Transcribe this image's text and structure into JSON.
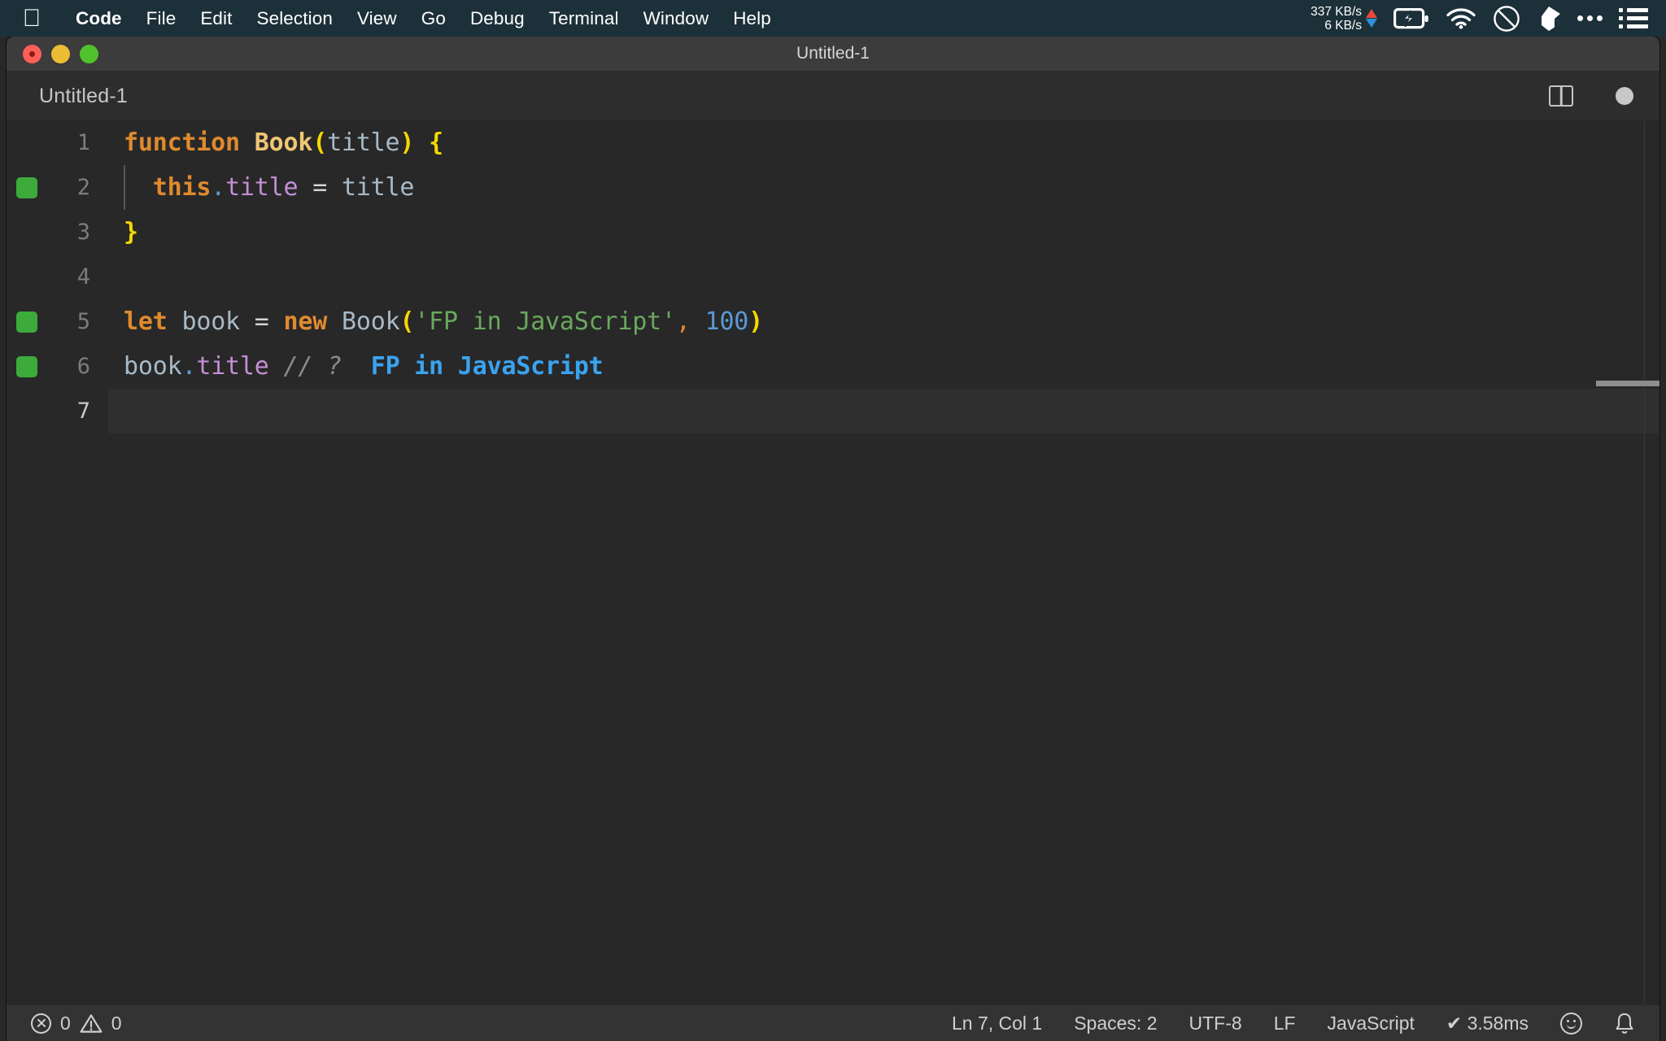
{
  "menubar": {
    "apple_icon": "apple-logo",
    "items": [
      {
        "label": "Code",
        "bold": true
      },
      {
        "label": "File",
        "bold": false
      },
      {
        "label": "Edit",
        "bold": false
      },
      {
        "label": "Selection",
        "bold": false
      },
      {
        "label": "View",
        "bold": false
      },
      {
        "label": "Go",
        "bold": false
      },
      {
        "label": "Debug",
        "bold": false
      },
      {
        "label": "Terminal",
        "bold": false
      },
      {
        "label": "Window",
        "bold": false
      },
      {
        "label": "Help",
        "bold": false
      }
    ],
    "status": {
      "net_up": "337 KB/s",
      "net_down": "6 KB/s",
      "icons": [
        "battery-charging-icon",
        "wifi-icon",
        "do-not-disturb-icon",
        "dropbox-icon",
        "ellipsis-icon",
        "list-icon"
      ]
    }
  },
  "window": {
    "title": "Untitled-1",
    "traffic_lights": [
      "close-button",
      "minimize-button",
      "maximize-button"
    ]
  },
  "tabbar": {
    "active_tab": "Untitled-1",
    "split_editor_icon": "split-editor-icon",
    "unsaved_dot": "unsaved-indicator-dot"
  },
  "editor": {
    "language": "JavaScript",
    "lines": [
      {
        "num": "1",
        "marker": false,
        "active": false,
        "indent_guide": false,
        "tokens": [
          {
            "t": "function",
            "c": "t-kw"
          },
          {
            "t": " ",
            "c": "t-op"
          },
          {
            "t": "Book",
            "c": "t-fn"
          },
          {
            "t": "(",
            "c": "t-paren"
          },
          {
            "t": "title",
            "c": "t-var"
          },
          {
            "t": ")",
            "c": "t-paren"
          },
          {
            "t": " ",
            "c": "t-op"
          },
          {
            "t": "{",
            "c": "t-brace"
          }
        ]
      },
      {
        "num": "2",
        "marker": true,
        "active": false,
        "indent_guide": true,
        "tokens": [
          {
            "t": "  ",
            "c": "t-op"
          },
          {
            "t": "this",
            "c": "t-kw"
          },
          {
            "t": ".",
            "c": "t-dot"
          },
          {
            "t": "title",
            "c": "t-prop"
          },
          {
            "t": " = ",
            "c": "t-op"
          },
          {
            "t": "title",
            "c": "t-var"
          }
        ]
      },
      {
        "num": "3",
        "marker": false,
        "active": false,
        "indent_guide": false,
        "tokens": [
          {
            "t": "}",
            "c": "t-brace"
          }
        ]
      },
      {
        "num": "4",
        "marker": false,
        "active": false,
        "indent_guide": false,
        "tokens": []
      },
      {
        "num": "5",
        "marker": true,
        "active": false,
        "indent_guide": false,
        "tokens": [
          {
            "t": "let",
            "c": "t-kw"
          },
          {
            "t": " ",
            "c": "t-op"
          },
          {
            "t": "book",
            "c": "t-var"
          },
          {
            "t": " = ",
            "c": "t-op"
          },
          {
            "t": "new",
            "c": "t-kw"
          },
          {
            "t": " ",
            "c": "t-op"
          },
          {
            "t": "Book",
            "c": "t-var"
          },
          {
            "t": "(",
            "c": "t-paren"
          },
          {
            "t": "'FP in JavaScript'",
            "c": "t-str"
          },
          {
            "t": ",",
            "c": "t-comma"
          },
          {
            "t": " ",
            "c": "t-op"
          },
          {
            "t": "100",
            "c": "t-num"
          },
          {
            "t": ")",
            "c": "t-paren"
          }
        ]
      },
      {
        "num": "6",
        "marker": true,
        "active": false,
        "indent_guide": false,
        "tokens": [
          {
            "t": "book",
            "c": "t-var"
          },
          {
            "t": ".",
            "c": "t-dot"
          },
          {
            "t": "title",
            "c": "t-prop"
          },
          {
            "t": " ",
            "c": "t-op"
          },
          {
            "t": "// ?",
            "c": "t-comment"
          },
          {
            "t": "  ",
            "c": "t-op"
          },
          {
            "t": "FP in JavaScript",
            "c": "t-quokka"
          }
        ]
      },
      {
        "num": "7",
        "marker": false,
        "active": true,
        "indent_guide": false,
        "tokens": []
      }
    ]
  },
  "statusbar": {
    "errors": "0",
    "warnings": "0",
    "cursor": "Ln 7, Col 1",
    "indent": "Spaces: 2",
    "encoding": "UTF-8",
    "eol": "LF",
    "language": "JavaScript",
    "quokka": "✔ 3.58ms",
    "feedback_icon": "smiley-icon",
    "bell_icon": "bell-icon"
  }
}
